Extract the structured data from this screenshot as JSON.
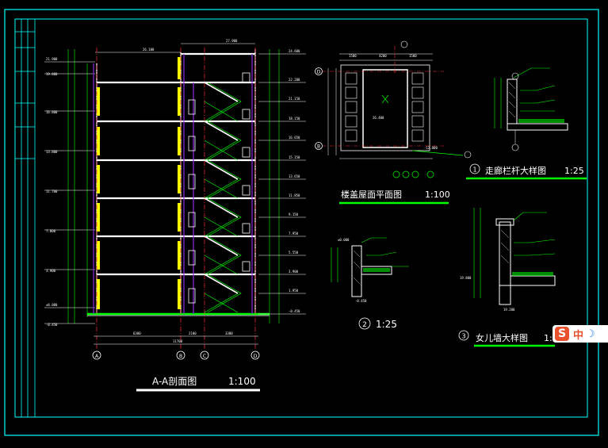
{
  "titles": {
    "section": "A-A剖面图",
    "section_scale": "1:100",
    "roof": "楼盖屋面平面图",
    "roof_scale": "1:100",
    "detail1": "走廊栏杆大样图",
    "detail1_num": "1",
    "detail1_scale": "1:25",
    "detail2_num": "2",
    "detail2_scale": "1:25",
    "detail3": "女儿墙大样图",
    "detail3_num": "3",
    "detail3_scale": "1:"
  },
  "axes": [
    "A",
    "B",
    "C",
    "D"
  ],
  "roof_axes": [
    "D",
    "B"
  ],
  "ime": {
    "logo": "S",
    "lang": "中",
    "mode": "☽"
  },
  "colors": {
    "frame": "#00ffff",
    "stair": "#00ff00",
    "slab": "#ffffff",
    "window": "#ffff00",
    "column": "#8a2be2",
    "axis": "#ff3030"
  }
}
